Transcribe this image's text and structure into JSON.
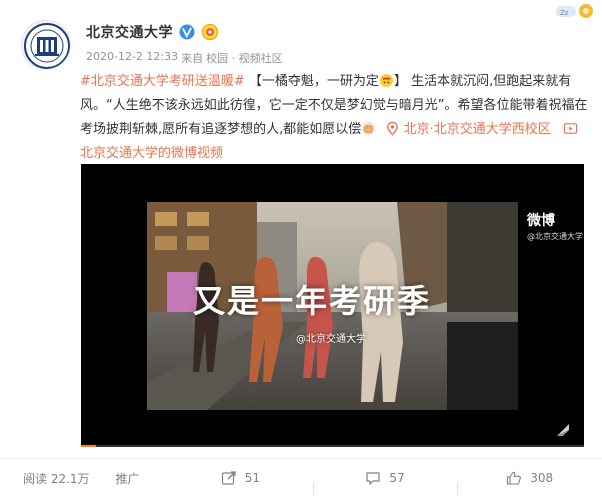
{
  "user": {
    "name": "北京交通大学",
    "time": "2020-12-2 12:33",
    "from_prefix": "来自",
    "source": "校园 · 视频社区"
  },
  "post": {
    "hashtag": "#北京交通大学考研送温暖#",
    "part1": " 【一橘夺魁，一研为定",
    "part2": "】 生活本就沉闷,但跑起来就有风。“人生绝不该永远如此彷徨，它一定不仅是梦幻觉与暗月光”。希望各位能带着祝福在考场披荆斩棘,愿所有追逐梦想的人,都能如愿以偿",
    "location": "北京·北京交通大学西校区",
    "video_link": "北京交通大学的微博视频"
  },
  "video": {
    "title": "又是一年考研季",
    "watermark": "@北京交通大学",
    "logo_text": "微博",
    "logo_sub": "@北京交通大学",
    "progress": 0.03
  },
  "footer": {
    "reads": "阅读 22.1万",
    "promote": "推广",
    "reposts": "51",
    "comments": "57",
    "likes": "308"
  },
  "colors": {
    "accent": "#eb7350",
    "progress": "#ff8200"
  }
}
